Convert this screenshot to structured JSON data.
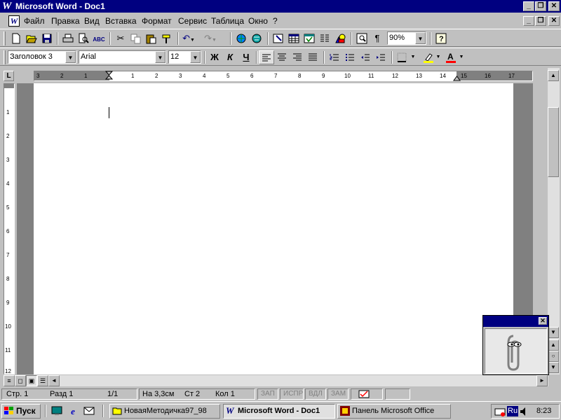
{
  "window": {
    "title": "Microsoft Word - Doc1",
    "app_icon": "W",
    "title_buttons": [
      "_",
      "❐",
      "✕"
    ]
  },
  "menu": {
    "doc_icon": "W",
    "items": [
      "Файл",
      "Правка",
      "Вид",
      "Вставка",
      "Формат",
      "Сервис",
      "Таблица",
      "Окно",
      "?"
    ],
    "doc_buttons": [
      "_",
      "❐",
      "✕"
    ]
  },
  "standard_toolbar": {
    "zoom": "90%",
    "icons": [
      "new-document-icon",
      "open-folder-icon",
      "save-icon",
      "print-icon",
      "print-preview-icon",
      "spelling-icon",
      "cut-icon",
      "copy-icon",
      "paste-icon",
      "format-painter-icon",
      "undo-icon",
      "redo-icon",
      "insert-hyperlink-icon",
      "web-toolbar-icon",
      "tables-borders-icon",
      "insert-table-icon",
      "insert-excel-icon",
      "columns-icon",
      "drawing-icon",
      "document-map-icon",
      "show-formatting-icon",
      "help-icon"
    ]
  },
  "format_toolbar": {
    "style": "Заголовок 3",
    "font": "Arial",
    "size": "12",
    "bold": "Ж",
    "italic": "К",
    "underline": "Ч",
    "highlight_color": "#ffff00",
    "font_color": "#ff0000"
  },
  "ruler": {
    "ticks": [
      "3",
      "2",
      "1",
      "1",
      "2",
      "3",
      "4",
      "5",
      "6",
      "7",
      "8",
      "9",
      "10",
      "11",
      "12",
      "13",
      "14",
      "15",
      "16",
      "17"
    ],
    "vticks": [
      "1",
      "2",
      "3",
      "4",
      "5",
      "6",
      "7",
      "8",
      "9",
      "10",
      "11",
      "12"
    ],
    "tab_stop": "L"
  },
  "status": {
    "page": "Стр. 1",
    "section": "Разд 1",
    "page_of": "1/1",
    "at": "На 3,3см",
    "line": "Ст 2",
    "col": "Кол 1",
    "rec": "ЗАП",
    "trk": "ИСПР",
    "ext": "ВДЛ",
    "ovr": "ЗАМ"
  },
  "taskbar": {
    "start": "Пуск",
    "tasks": [
      "НоваяМетодичка97_98",
      "Microsoft Word - Doc1",
      "Панель Microsoft Office"
    ],
    "lang": "Ru",
    "clock": "8:23"
  }
}
